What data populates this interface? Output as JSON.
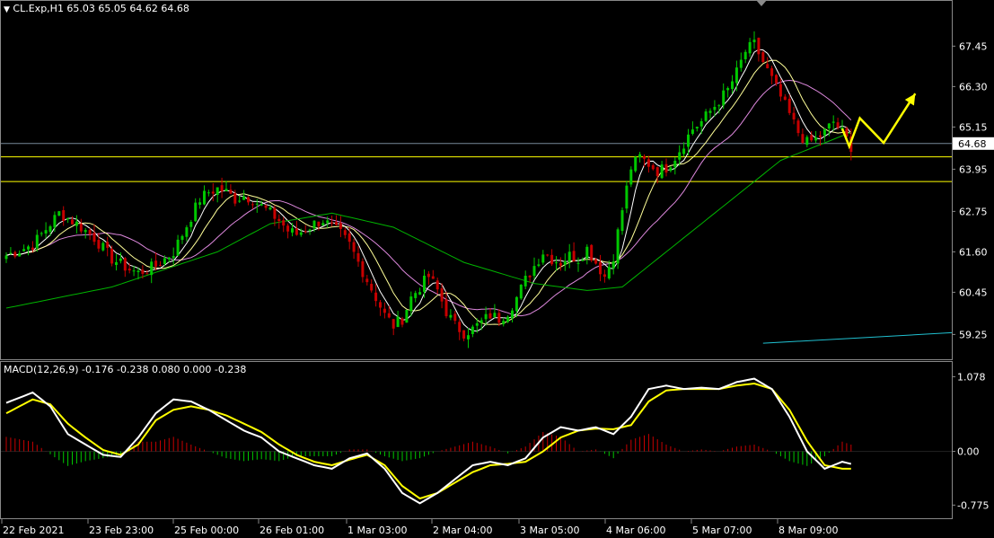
{
  "header": {
    "symbol_line": "CL.Exp,H1  65.03 65.05 64.62 64.68",
    "macd_line": "MACD(12,26,9) -0.176 -0.238 0.080 0.000 -0.238"
  },
  "colors": {
    "background": "#000000",
    "bull_candle": "#00c800",
    "bear_candle": "#c80000",
    "ma_fast": "#ffffff",
    "ma_mid": "#ffff99",
    "ma_slow": "#dd88dd",
    "ma_long": "#00b400",
    "trend_line": "#20c0d0",
    "level_line": "#ffff00",
    "current_price_line": "#778899",
    "projection_arrow": "#ffff00",
    "macd_main": "#ffffff",
    "macd_signal": "#ffff00"
  },
  "chart_data": [
    {
      "type": "candlestick",
      "name": "CL.Exp,H1",
      "ylim": [
        58.8,
        68.2
      ],
      "y_ticks": [
        "67.45",
        "66.30",
        "65.15",
        "63.95",
        "62.75",
        "61.60",
        "60.45",
        "59.25"
      ],
      "current_price": "64.68",
      "x_labels": [
        "22 Feb 2021",
        "23 Feb 23:00",
        "25 Feb 00:00",
        "26 Feb 01:00",
        "1 Mar 03:00",
        "2 Mar 04:00",
        "3 Mar 05:00",
        "4 Mar 06:00",
        "5 Mar 07:00",
        "8 Mar 09:00"
      ],
      "horizontal_levels": [
        64.3,
        63.6
      ],
      "price_path": [
        [
          0,
          61.5
        ],
        [
          3,
          61.8
        ],
        [
          5,
          62.4
        ],
        [
          6,
          62.7
        ],
        [
          8,
          62.4
        ],
        [
          10,
          62.0
        ],
        [
          11,
          61.7
        ],
        [
          12,
          61.4
        ],
        [
          14,
          61.1
        ],
        [
          15,
          61.0
        ],
        [
          17,
          61.2
        ],
        [
          19,
          61.6
        ],
        [
          21,
          62.6
        ],
        [
          22,
          63.1
        ],
        [
          23,
          63.3
        ],
        [
          24,
          63.4
        ],
        [
          25,
          63.3
        ],
        [
          26,
          63.1
        ],
        [
          27,
          63.2
        ],
        [
          28,
          63.1
        ],
        [
          29,
          62.9
        ],
        [
          30,
          62.7
        ],
        [
          31,
          62.5
        ],
        [
          32,
          62.2
        ],
        [
          33,
          62.1
        ],
        [
          35,
          62.4
        ],
        [
          36,
          62.5
        ],
        [
          37,
          62.3
        ],
        [
          38,
          62.1
        ],
        [
          39,
          61.8
        ],
        [
          40,
          61.3
        ],
        [
          41,
          60.8
        ],
        [
          42,
          60.3
        ],
        [
          43,
          59.8
        ],
        [
          44,
          59.5
        ],
        [
          45,
          59.7
        ],
        [
          46,
          60.3
        ],
        [
          47,
          60.6
        ],
        [
          48,
          60.9
        ],
        [
          49,
          60.5
        ],
        [
          50,
          59.9
        ],
        [
          51,
          59.5
        ],
        [
          52,
          59.3
        ],
        [
          53,
          59.4
        ],
        [
          54,
          59.6
        ],
        [
          55,
          59.8
        ],
        [
          56,
          59.7
        ],
        [
          57,
          59.9
        ],
        [
          58,
          60.3
        ],
        [
          59,
          60.8
        ],
        [
          60,
          61.2
        ],
        [
          61,
          61.6
        ],
        [
          62,
          61.4
        ],
        [
          63,
          61.3
        ],
        [
          64,
          61.5
        ],
        [
          65,
          61.4
        ],
        [
          66,
          61.7
        ],
        [
          67,
          61.3
        ],
        [
          68,
          60.9
        ],
        [
          69,
          61.5
        ],
        [
          70,
          62.8
        ],
        [
          71,
          64.0
        ],
        [
          72,
          64.3
        ],
        [
          73,
          64.1
        ],
        [
          74,
          63.9
        ],
        [
          75,
          64.0
        ],
        [
          76,
          64.3
        ],
        [
          77,
          64.7
        ],
        [
          78,
          65.1
        ],
        [
          79,
          65.3
        ],
        [
          80,
          65.6
        ],
        [
          81,
          65.9
        ],
        [
          82,
          66.2
        ],
        [
          83,
          66.7
        ],
        [
          84,
          67.3
        ],
        [
          85,
          67.5
        ],
        [
          86,
          67.0
        ],
        [
          87,
          66.5
        ],
        [
          88,
          66.0
        ],
        [
          89,
          65.5
        ],
        [
          90,
          65.0
        ],
        [
          91,
          64.7
        ],
        [
          92,
          64.8
        ],
        [
          93,
          65.0
        ],
        [
          94,
          65.3
        ],
        [
          95,
          65.0
        ],
        [
          96,
          64.6
        ]
      ],
      "long_ma_path": [
        [
          0,
          60.0
        ],
        [
          12,
          60.6
        ],
        [
          24,
          61.6
        ],
        [
          30,
          62.4
        ],
        [
          37,
          62.7
        ],
        [
          44,
          62.3
        ],
        [
          52,
          61.3
        ],
        [
          60,
          60.7
        ],
        [
          66,
          60.5
        ],
        [
          70,
          60.6
        ],
        [
          76,
          61.8
        ],
        [
          82,
          63.0
        ],
        [
          88,
          64.2
        ],
        [
          96,
          65.0
        ]
      ],
      "trend_line": [
        [
          86,
          59.0
        ],
        [
          108,
          59.3
        ]
      ],
      "projection_arrow": [
        [
          95,
          65.1
        ],
        [
          95.8,
          64.6
        ],
        [
          97,
          65.4
        ],
        [
          99.7,
          64.7
        ],
        [
          103.3,
          66.1
        ]
      ]
    },
    {
      "type": "line",
      "name": "MACD(12,26,9)",
      "ylim": [
        -0.9,
        1.2
      ],
      "y_ticks": [
        "1.078",
        "0.00",
        "-0.775"
      ],
      "series": [
        {
          "name": "",
          "points": [
            [
              0,
              0.7
            ],
            [
              3,
              0.85
            ],
            [
              5,
              0.65
            ],
            [
              7,
              0.25
            ],
            [
              9,
              0.1
            ],
            [
              11,
              -0.05
            ],
            [
              13,
              -0.08
            ],
            [
              15,
              0.2
            ],
            [
              17,
              0.55
            ],
            [
              19,
              0.75
            ],
            [
              21,
              0.72
            ],
            [
              23,
              0.6
            ],
            [
              25,
              0.45
            ],
            [
              27,
              0.3
            ],
            [
              29,
              0.2
            ],
            [
              31,
              0.0
            ],
            [
              33,
              -0.1
            ],
            [
              35,
              -0.2
            ],
            [
              37,
              -0.25
            ],
            [
              39,
              -0.1
            ],
            [
              41,
              -0.03
            ],
            [
              43,
              -0.25
            ],
            [
              45,
              -0.6
            ],
            [
              47,
              -0.75
            ],
            [
              49,
              -0.6
            ],
            [
              51,
              -0.4
            ],
            [
              53,
              -0.2
            ],
            [
              55,
              -0.15
            ],
            [
              57,
              -0.2
            ],
            [
              59,
              -0.1
            ],
            [
              61,
              0.2
            ],
            [
              63,
              0.35
            ],
            [
              65,
              0.3
            ],
            [
              67,
              0.35
            ],
            [
              69,
              0.25
            ],
            [
              71,
              0.5
            ],
            [
              73,
              0.9
            ],
            [
              75,
              0.95
            ],
            [
              77,
              0.9
            ],
            [
              79,
              0.92
            ],
            [
              81,
              0.9
            ],
            [
              83,
              1.0
            ],
            [
              85,
              1.05
            ],
            [
              87,
              0.9
            ],
            [
              89,
              0.5
            ],
            [
              91,
              0.0
            ],
            [
              93,
              -0.25
            ],
            [
              95,
              -0.15
            ],
            [
              96,
              -0.18
            ]
          ]
        },
        {
          "name": "",
          "points": [
            [
              0,
              0.55
            ],
            [
              3,
              0.75
            ],
            [
              5,
              0.68
            ],
            [
              7,
              0.4
            ],
            [
              9,
              0.2
            ],
            [
              11,
              0.02
            ],
            [
              13,
              -0.05
            ],
            [
              15,
              0.1
            ],
            [
              17,
              0.45
            ],
            [
              19,
              0.6
            ],
            [
              21,
              0.65
            ],
            [
              23,
              0.6
            ],
            [
              25,
              0.52
            ],
            [
              27,
              0.4
            ],
            [
              29,
              0.28
            ],
            [
              31,
              0.1
            ],
            [
              33,
              -0.05
            ],
            [
              35,
              -0.15
            ],
            [
              37,
              -0.2
            ],
            [
              39,
              -0.12
            ],
            [
              41,
              -0.05
            ],
            [
              43,
              -0.2
            ],
            [
              45,
              -0.5
            ],
            [
              47,
              -0.68
            ],
            [
              49,
              -0.6
            ],
            [
              51,
              -0.45
            ],
            [
              53,
              -0.3
            ],
            [
              55,
              -0.2
            ],
            [
              57,
              -0.18
            ],
            [
              59,
              -0.15
            ],
            [
              61,
              0.0
            ],
            [
              63,
              0.2
            ],
            [
              65,
              0.3
            ],
            [
              67,
              0.33
            ],
            [
              69,
              0.32
            ],
            [
              71,
              0.38
            ],
            [
              73,
              0.72
            ],
            [
              75,
              0.88
            ],
            [
              77,
              0.9
            ],
            [
              79,
              0.9
            ],
            [
              81,
              0.9
            ],
            [
              83,
              0.95
            ],
            [
              85,
              0.98
            ],
            [
              87,
              0.9
            ],
            [
              89,
              0.6
            ],
            [
              91,
              0.15
            ],
            [
              93,
              -0.2
            ],
            [
              95,
              -0.25
            ],
            [
              96,
              -0.25
            ]
          ]
        }
      ]
    }
  ]
}
